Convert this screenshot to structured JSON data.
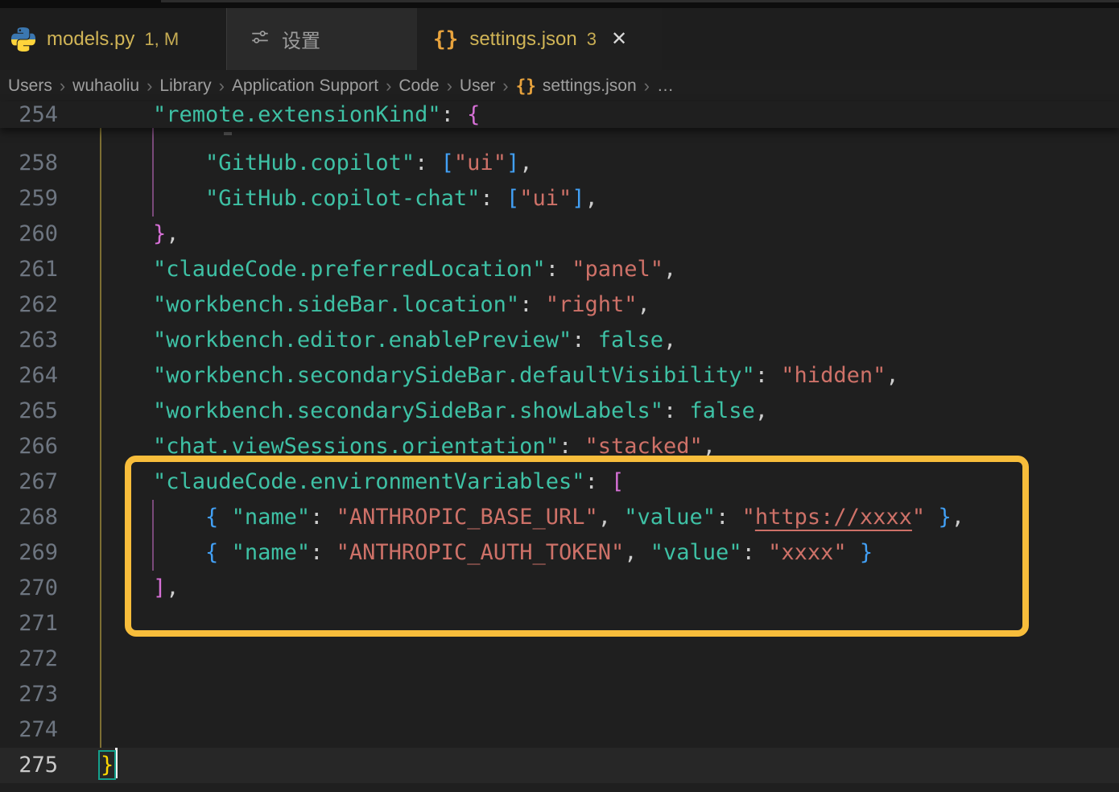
{
  "colors": {
    "gold_tab": "#d0b456",
    "orange_icon": "#e8a33d",
    "box_orange": "#f7bd3b",
    "key_teal": "#3ec1a5",
    "value_salmon": "#ce7168",
    "bracket_gold": "#ffd702",
    "bracket_pink": "#d670d6",
    "bracket_blue": "#42a0f5",
    "match_border": "#14a08c",
    "guide_gold": "#7d6f33",
    "guide_purple": "#7a4a7a"
  },
  "tabs": [
    {
      "label": "models.py",
      "decoration": "1, M",
      "icon": "python-logo"
    },
    {
      "label": "设置",
      "icon": "sliders"
    },
    {
      "label": "settings.json",
      "decoration": "3",
      "icon": "json-braces",
      "close": "✕",
      "active": true
    }
  ],
  "breadcrumb": {
    "items": [
      "Users",
      "wuhaoliu",
      "Library",
      "Application Support",
      "Code",
      "User",
      "settings.json",
      "…"
    ],
    "separator": "›"
  },
  "editor": {
    "sticky": {
      "num": "254",
      "tokens": [
        [
          "ind",
          "    "
        ],
        [
          "key",
          "\"remote.extensionKind\""
        ],
        [
          "pun",
          ": "
        ],
        [
          "b2",
          "{"
        ]
      ]
    },
    "lines": [
      {
        "num": "258",
        "tokens": [
          [
            "ind",
            "        "
          ],
          [
            "key",
            "\"GitHub.copilot\""
          ],
          [
            "pun",
            ": "
          ],
          [
            "b3",
            "["
          ],
          [
            "str",
            "\"ui\""
          ],
          [
            "b3",
            "]"
          ],
          [
            "pun",
            ","
          ]
        ]
      },
      {
        "num": "259",
        "tokens": [
          [
            "ind",
            "        "
          ],
          [
            "key",
            "\"GitHub.copilot-chat\""
          ],
          [
            "pun",
            ": "
          ],
          [
            "b3",
            "["
          ],
          [
            "str",
            "\"ui\""
          ],
          [
            "b3",
            "]"
          ],
          [
            "pun",
            ","
          ]
        ]
      },
      {
        "num": "260",
        "tokens": [
          [
            "ind",
            "    "
          ],
          [
            "b2",
            "}"
          ],
          [
            "pun",
            ","
          ]
        ]
      },
      {
        "num": "261",
        "tokens": [
          [
            "ind",
            "    "
          ],
          [
            "key",
            "\"claudeCode.preferredLocation\""
          ],
          [
            "pun",
            ": "
          ],
          [
            "str",
            "\"panel\""
          ],
          [
            "pun",
            ","
          ]
        ]
      },
      {
        "num": "262",
        "tokens": [
          [
            "ind",
            "    "
          ],
          [
            "key",
            "\"workbench.sideBar.location\""
          ],
          [
            "pun",
            ": "
          ],
          [
            "str",
            "\"right\""
          ],
          [
            "pun",
            ","
          ]
        ]
      },
      {
        "num": "263",
        "tokens": [
          [
            "ind",
            "    "
          ],
          [
            "key",
            "\"workbench.editor.enablePreview\""
          ],
          [
            "pun",
            ": "
          ],
          [
            "kw",
            "false"
          ],
          [
            "pun",
            ","
          ]
        ]
      },
      {
        "num": "264",
        "tokens": [
          [
            "ind",
            "    "
          ],
          [
            "key",
            "\"workbench.secondarySideBar.defaultVisibility\""
          ],
          [
            "pun",
            ": "
          ],
          [
            "str",
            "\"hidden\""
          ],
          [
            "pun",
            ","
          ]
        ]
      },
      {
        "num": "265",
        "tokens": [
          [
            "ind",
            "    "
          ],
          [
            "key",
            "\"workbench.secondarySideBar.showLabels\""
          ],
          [
            "pun",
            ": "
          ],
          [
            "kw",
            "false"
          ],
          [
            "pun",
            ","
          ]
        ]
      },
      {
        "num": "266",
        "tokens": [
          [
            "ind",
            "    "
          ],
          [
            "key",
            "\"chat.viewSessions.orientation\""
          ],
          [
            "pun",
            ": "
          ],
          [
            "str",
            "\"stacked\""
          ],
          [
            "pun",
            ","
          ]
        ]
      },
      {
        "num": "267",
        "tokens": [
          [
            "ind",
            "    "
          ],
          [
            "key",
            "\"claudeCode.environmentVariables\""
          ],
          [
            "pun",
            ": "
          ],
          [
            "b2",
            "["
          ]
        ]
      },
      {
        "num": "268",
        "tokens": [
          [
            "ind",
            "        "
          ],
          [
            "b3",
            "{"
          ],
          [
            "pun",
            " "
          ],
          [
            "key",
            "\"name\""
          ],
          [
            "pun",
            ": "
          ],
          [
            "str",
            "\"ANTHROPIC_BASE_URL\""
          ],
          [
            "pun",
            ", "
          ],
          [
            "key",
            "\"value\""
          ],
          [
            "pun",
            ": "
          ],
          [
            "str",
            "\""
          ],
          [
            "link",
            "https://xxxx"
          ],
          [
            "str",
            "\""
          ],
          [
            "pun",
            " "
          ],
          [
            "b3",
            "}"
          ],
          [
            "pun",
            ","
          ]
        ]
      },
      {
        "num": "269",
        "tokens": [
          [
            "ind",
            "        "
          ],
          [
            "b3",
            "{"
          ],
          [
            "pun",
            " "
          ],
          [
            "key",
            "\"name\""
          ],
          [
            "pun",
            ": "
          ],
          [
            "str",
            "\"ANTHROPIC_AUTH_TOKEN\""
          ],
          [
            "pun",
            ", "
          ],
          [
            "key",
            "\"value\""
          ],
          [
            "pun",
            ": "
          ],
          [
            "str",
            "\"xxxx\""
          ],
          [
            "pun",
            " "
          ],
          [
            "b3",
            "}"
          ]
        ]
      },
      {
        "num": "270",
        "tokens": [
          [
            "ind",
            "    "
          ],
          [
            "b2",
            "]"
          ],
          [
            "pun",
            ","
          ]
        ]
      },
      {
        "num": "271",
        "tokens": []
      },
      {
        "num": "272",
        "tokens": []
      },
      {
        "num": "273",
        "tokens": []
      },
      {
        "num": "274",
        "tokens": []
      },
      {
        "num": "275",
        "tokens": [
          [
            "match",
            "}"
          ],
          [
            "cursor",
            ""
          ]
        ],
        "current": true
      }
    ]
  }
}
